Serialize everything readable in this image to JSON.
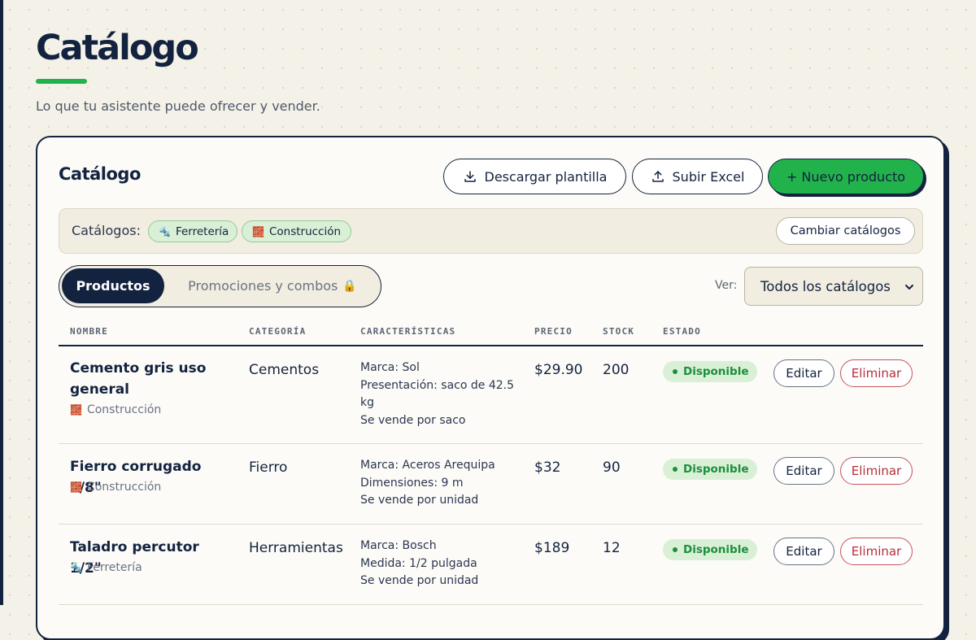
{
  "page": {
    "title": "Catálogo",
    "subtitle": "Lo que tu asistente puede ofrecer y vender."
  },
  "card": {
    "title": "Catálogo",
    "buttons": {
      "download": "Descargar plantilla",
      "upload": "Subir Excel",
      "new_product": "+ Nuevo producto"
    },
    "catalogs": {
      "label": "Catálogos:",
      "chips": [
        {
          "icon": "🔩",
          "label": "Ferretería"
        },
        {
          "icon": "🧱",
          "label": "Construcción"
        }
      ],
      "change_button": "Cambiar catálogos"
    },
    "tabs": [
      {
        "label": "Productos",
        "active": true
      },
      {
        "label": "Promociones y combos",
        "locked": true,
        "lock_icon": "🔒"
      }
    ],
    "view": {
      "label": "Ver:",
      "selected": "Todos los catálogos"
    },
    "table": {
      "headers": [
        "NOMBRE",
        "CATEGORÍA",
        "CARACTERÍSTICAS",
        "PRECIO",
        "STOCK",
        "ESTADO"
      ],
      "rows": [
        {
          "name_lines": [
            "Cemento gris uso",
            "general"
          ],
          "catalog_icon": "🧱",
          "catalog": "Construcción",
          "category": "Cementos",
          "features": [
            "Marca: Sol",
            "Presentación: saco de 42.5",
            "kg",
            "Se vende por saco"
          ],
          "price": "$29.90",
          "stock": "200",
          "status": "Disponible",
          "edit": "Editar",
          "delete": "Eliminar"
        },
        {
          "name_lines": [
            "Fierro corrugado 3/8\""
          ],
          "catalog_icon": "🧱",
          "catalog": "Construcción",
          "category": "Fierro",
          "features": [
            "Marca: Aceros Arequipa",
            "Dimensiones: 9 m",
            "Se vende por unidad"
          ],
          "price": "$32",
          "stock": "90",
          "status": "Disponible",
          "edit": "Editar",
          "delete": "Eliminar"
        },
        {
          "name_lines": [
            "Taladro percutor 1/2\""
          ],
          "catalog_icon": "🔩",
          "catalog": "Ferretería",
          "category": "Herramientas",
          "features": [
            "Marca: Bosch",
            "Medida: 1/2 pulgada",
            "Se vende por unidad"
          ],
          "price": "$189",
          "stock": "12",
          "status": "Disponible",
          "edit": "Editar",
          "delete": "Eliminar"
        }
      ]
    }
  },
  "colors": {
    "navy": "#13233f",
    "accent_green": "#22b24c",
    "status_green": "#1c8f3c",
    "danger_red": "#b42f39",
    "background": "#f4f1e8"
  },
  "icons": {
    "download": "download-icon",
    "upload": "upload-icon",
    "select_chevron": "chevron-down-icon"
  }
}
